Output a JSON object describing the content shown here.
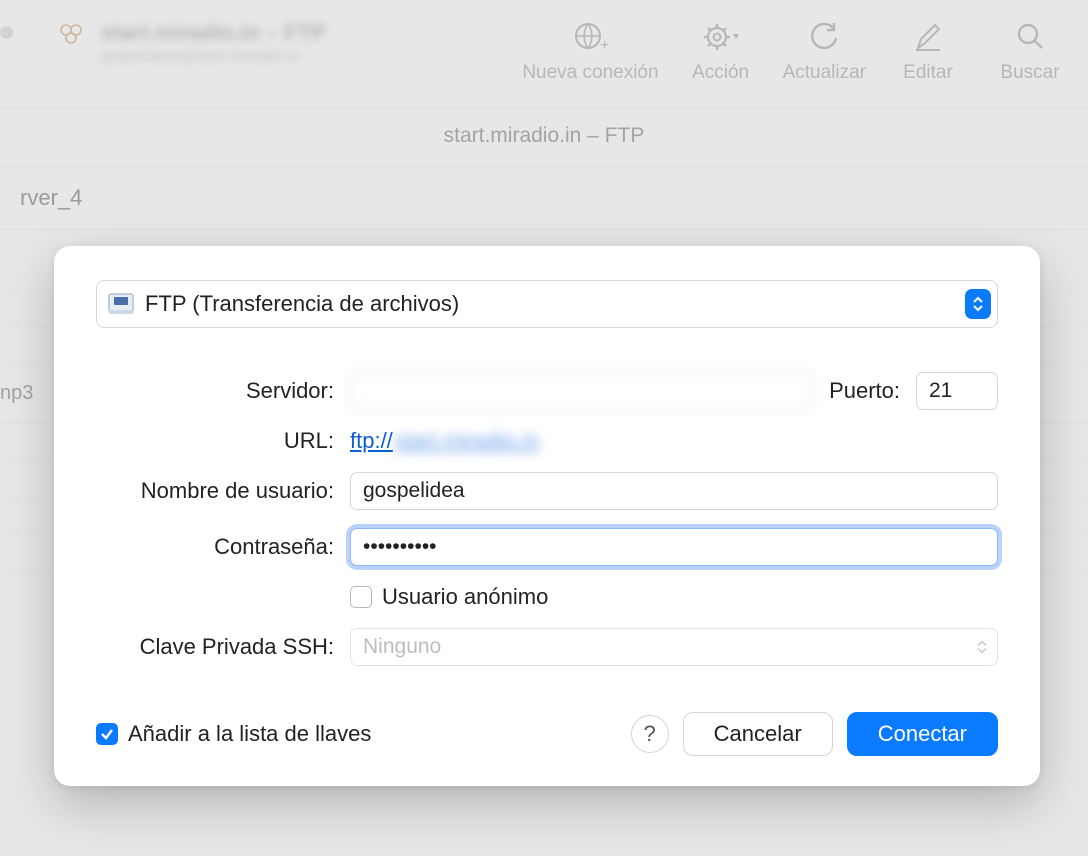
{
  "toolbar": {
    "new_connection": "Nueva conexión",
    "action": "Acción",
    "refresh": "Actualizar",
    "edit": "Editar",
    "search": "Buscar"
  },
  "window": {
    "subtitle": "start.miradio.in – FTP",
    "path_segment": "rver_4",
    "list_item": "np3"
  },
  "dialog": {
    "protocol": "FTP (Transferencia de archivos)",
    "labels": {
      "server": "Servidor:",
      "port": "Puerto:",
      "url": "URL:",
      "username": "Nombre de usuario:",
      "password": "Contraseña:",
      "anonymous": "Usuario anónimo",
      "ssh_key": "Clave Privada SSH:"
    },
    "values": {
      "server": "",
      "port": "21",
      "url_prefix": "ftp://",
      "username": "gospelidea",
      "password": "••••••••••",
      "ssh_key": "Ninguno"
    },
    "footer": {
      "add_keychain": "Añadir a la lista de llaves",
      "help": "?",
      "cancel": "Cancelar",
      "connect": "Conectar"
    }
  }
}
